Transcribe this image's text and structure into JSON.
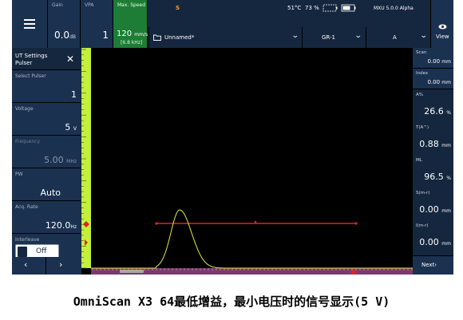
{
  "topbar": {
    "gain": {
      "label": "Gain",
      "value": "0.0",
      "unit": "dB"
    },
    "vpa": {
      "label": "VPA",
      "value": "1"
    },
    "max_speed": {
      "label": "Max. Speed",
      "value": "120",
      "unit": "mm/s",
      "sub": "[6.8 kHz]"
    },
    "s_indicator": "S",
    "temperature": "51°C",
    "battery_percent": "73 %",
    "version": "MXU 5.0.0 Alpha",
    "file_name": "Unnamed*",
    "group": "GR-1",
    "channel": "A",
    "view_label": "View"
  },
  "left_panel": {
    "title_line1": "UT Settings",
    "title_line2": "Pulser",
    "params": [
      {
        "label": "Select Pulser",
        "value": "1",
        "unit": "",
        "dim": false
      },
      {
        "label": "Voltage",
        "value": "5",
        "unit": "V",
        "dim": false
      },
      {
        "label": "Frequency",
        "value": "5.00",
        "unit": "MHz",
        "dim": true
      },
      {
        "label": "PW",
        "value": "Auto",
        "unit": "",
        "dim": false
      },
      {
        "label": "Acq. Rate",
        "value": "120.0",
        "unit": "Hz",
        "dim": false
      }
    ],
    "interleave": {
      "label": "Interleave",
      "value": "Off"
    }
  },
  "right_panel": {
    "scan": {
      "label": "Scan",
      "value": "0.00",
      "unit": "mm"
    },
    "index": {
      "label": "Index",
      "value": "0.00",
      "unit": "mm"
    },
    "readings": [
      {
        "label": "A%",
        "value": "26.6",
        "unit": "%"
      },
      {
        "label": "T(A^)",
        "value": "0.88",
        "unit": "mm"
      },
      {
        "label": "ML",
        "value": "96.5",
        "unit": "%"
      },
      {
        "label": "S(m-r)",
        "value": "0.00",
        "unit": "mm"
      },
      {
        "label": "I(m-r)",
        "value": "0.00",
        "unit": "mm"
      }
    ],
    "next_label": "Next›"
  },
  "colors": {
    "panel_bg": "#15273f",
    "button_bg": "#1b3150",
    "speed_green": "#1d7d35",
    "signal_yellow": "#e8e832",
    "gate_red": "#e0232a",
    "ruler_green": "#c4f03c",
    "ruler_purple": "#7a3a6d"
  },
  "caption": "OmniScan X3 64最低增益，最小电压时的信号显示(5 V)"
}
